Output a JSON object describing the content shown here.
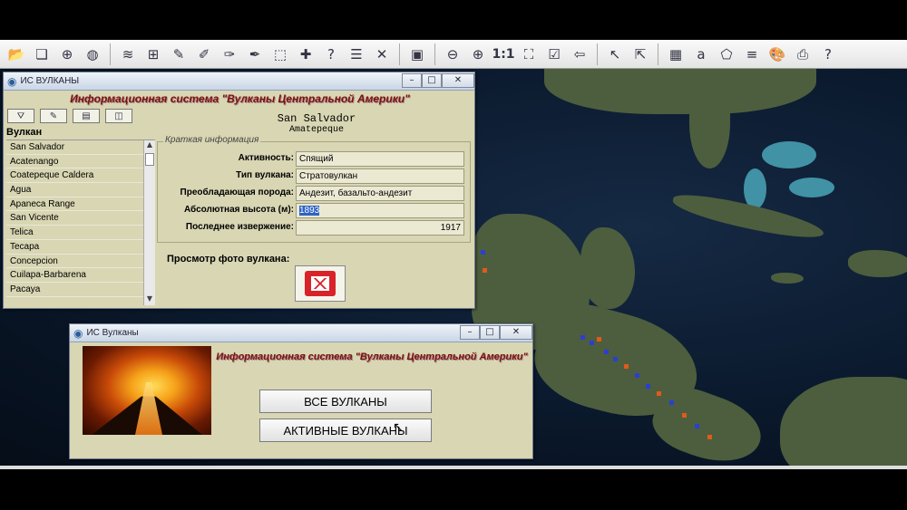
{
  "toolbar": {
    "icons": [
      "open-icon",
      "layers-icon",
      "add-layer-icon",
      "globe-layer-icon",
      "stack-icon",
      "select-layer-icon",
      "pin-icon",
      "pin-label-icon",
      "pin-remove-icon",
      "pin-info-icon",
      "select-rect-icon",
      "pin-add-icon",
      "pin-query-icon",
      "list-icon",
      "edit-icon",
      "map-window-icon",
      "zoom-out-icon",
      "zoom-in-icon",
      "scale-icon",
      "fit-icon",
      "check-icon",
      "back-icon",
      "pointer-icon",
      "info-pointer-icon",
      "table-icon",
      "label-icon",
      "polygon-icon",
      "text-icon",
      "palette-icon",
      "print-icon",
      "help-icon"
    ],
    "scale_label": "1:1"
  },
  "window_main": {
    "title": "ИС ВУЛКАНЫ",
    "banner": "Информационная система \"Вулканы Центральной Америки\"",
    "list_header": "Вулкан",
    "volcanoes": [
      "San Salvador",
      "Acatenango",
      "Coatepeque Caldera",
      "Agua",
      "Apaneca Range",
      "San Vicente",
      "Telica",
      "Tecapa",
      "Concepcion",
      "Cuilapa-Barbarena",
      "Pacaya"
    ],
    "selected_name": "San Salvador",
    "selected_subtitle": "Amatepeque",
    "info_group_label": "Краткая информация",
    "fields": [
      {
        "label": "Активность:",
        "value": "Спящий"
      },
      {
        "label": "Тип вулкана:",
        "value": "Стратовулкан"
      },
      {
        "label": "Преобладающая порода:",
        "value": "Андезит, базальто-андезит"
      },
      {
        "label": "Абсолютная высота (м):",
        "value": "1893"
      },
      {
        "label": "Последнее извержение:",
        "value": "1917"
      }
    ],
    "photo_label": "Просмотр фото вулкана:"
  },
  "window_start": {
    "title": "ИС Вулканы",
    "banner": "Информационная система \"Вулканы Центральной Америки\"",
    "btn_all": "ВСЕ ВУЛКАНЫ",
    "btn_active": "АКТИВНЫЕ ВУЛКАНЫ"
  },
  "colors": {
    "window_bg": "#d8d6b3",
    "banner": "#7a1010",
    "highlight": "#2f62c5",
    "volcano_marker_active": "#e05a1a",
    "volcano_marker": "#2b3fd0"
  }
}
